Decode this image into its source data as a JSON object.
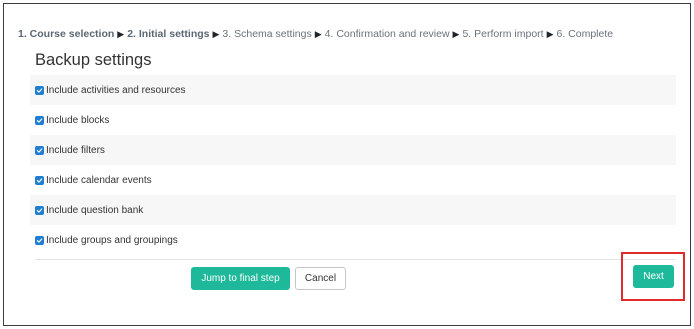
{
  "breadcrumb": {
    "steps": [
      {
        "label": "1. Course selection",
        "state": "done"
      },
      {
        "label": "2. Initial settings",
        "state": "current"
      },
      {
        "label": "3. Schema settings",
        "state": "todo"
      },
      {
        "label": "4. Confirmation and review",
        "state": "todo"
      },
      {
        "label": "5. Perform import",
        "state": "todo"
      },
      {
        "label": "6. Complete",
        "state": "todo"
      }
    ],
    "separator_icon": "right-triangle-arrow"
  },
  "section": {
    "title": "Backup settings"
  },
  "settings": [
    {
      "label": "Include activities and resources",
      "checked": true
    },
    {
      "label": "Include blocks",
      "checked": true
    },
    {
      "label": "Include filters",
      "checked": true
    },
    {
      "label": "Include calendar events",
      "checked": true
    },
    {
      "label": "Include question bank",
      "checked": true
    },
    {
      "label": "Include groups and groupings",
      "checked": true
    }
  ],
  "buttons": {
    "jump_to_final": "Jump to final step",
    "cancel": "Cancel",
    "next": "Next"
  },
  "colors": {
    "primary_button": "#1eb99a",
    "checkbox": "#1f7ed1",
    "highlight": "#e02b2b"
  }
}
